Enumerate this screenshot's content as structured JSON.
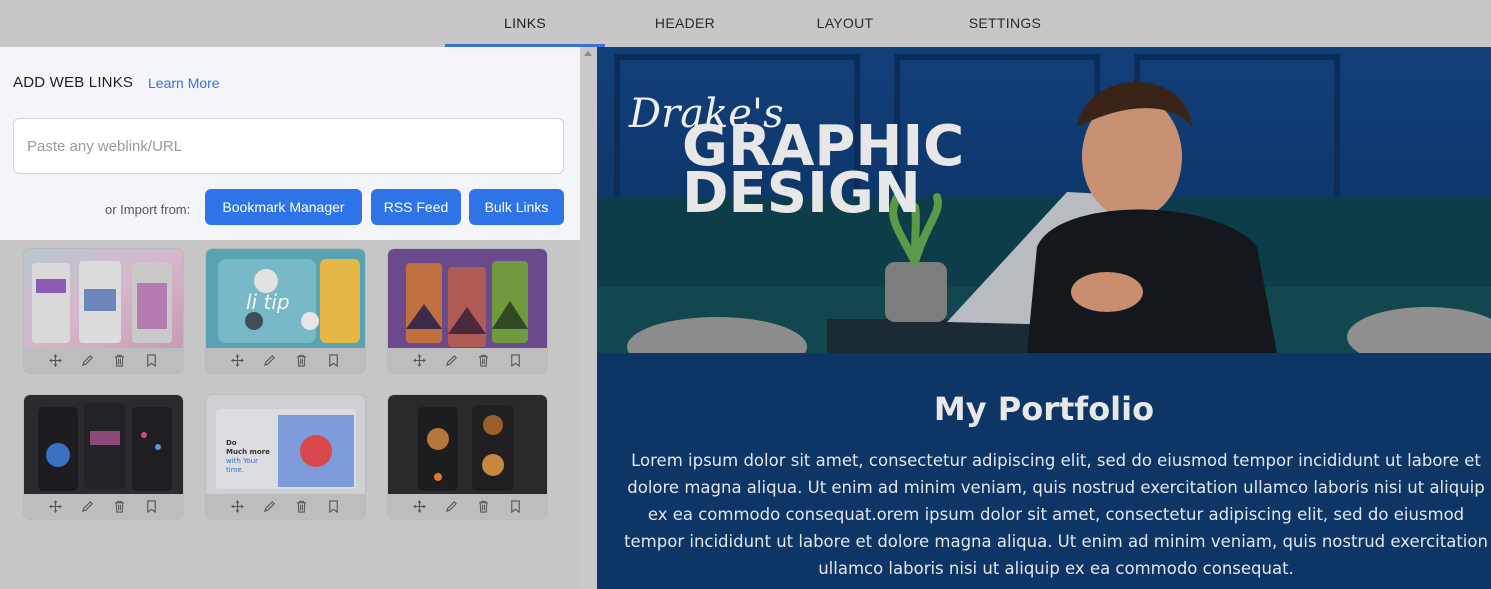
{
  "tabs": [
    {
      "label": "LINKS",
      "active": true
    },
    {
      "label": "HEADER",
      "active": false
    },
    {
      "label": "LAYOUT",
      "active": false
    },
    {
      "label": "SETTINGS",
      "active": false
    }
  ],
  "add_links": {
    "title": "ADD WEB LINKS",
    "learn_more": "Learn More",
    "input_placeholder": "Paste any weblink/URL",
    "input_value": "",
    "import_label": "or Import from:",
    "buttons": {
      "bookmark": "Bookmark Manager",
      "rss": "RSS Feed",
      "bulk": "Bulk Links"
    }
  },
  "thumbnails": [
    {
      "name": "colorful-app-ui"
    },
    {
      "name": "lamp-app-ui"
    },
    {
      "name": "mountain-travel-app-ui"
    },
    {
      "name": "dark-music-app-ui"
    },
    {
      "name": "alarm-app-ui",
      "text_lines": [
        "Do",
        "Much more",
        "with Your",
        "time."
      ]
    },
    {
      "name": "food-delivery-app-ui"
    }
  ],
  "card_tools": [
    "move-icon",
    "edit-icon",
    "delete-icon",
    "bookmark-icon"
  ],
  "preview": {
    "hero_script": "Drake's",
    "hero_line1": "GRAPHIC",
    "hero_line2": "DESIGN",
    "title": "My Portfolio",
    "body": "Lorem ipsum dolor sit amet, consectetur adipiscing elit, sed do eiusmod tempor incididunt ut labore et dolore magna aliqua. Ut enim ad minim veniam, quis nostrud exercitation ullamco laboris nisi ut aliquip ex ea commodo consequat.orem ipsum dolor sit amet, consectetur adipiscing elit, sed do eiusmod tempor incididunt ut labore et dolore magna aliqua. Ut enim ad minim veniam, quis nostrud exercitation ullamco laboris nisi ut aliquip ex ea commodo consequat."
  },
  "colors": {
    "accent": "#2f74e6",
    "tab_active_underline": "#3a6fd8",
    "preview_bg": "#0d3566"
  }
}
